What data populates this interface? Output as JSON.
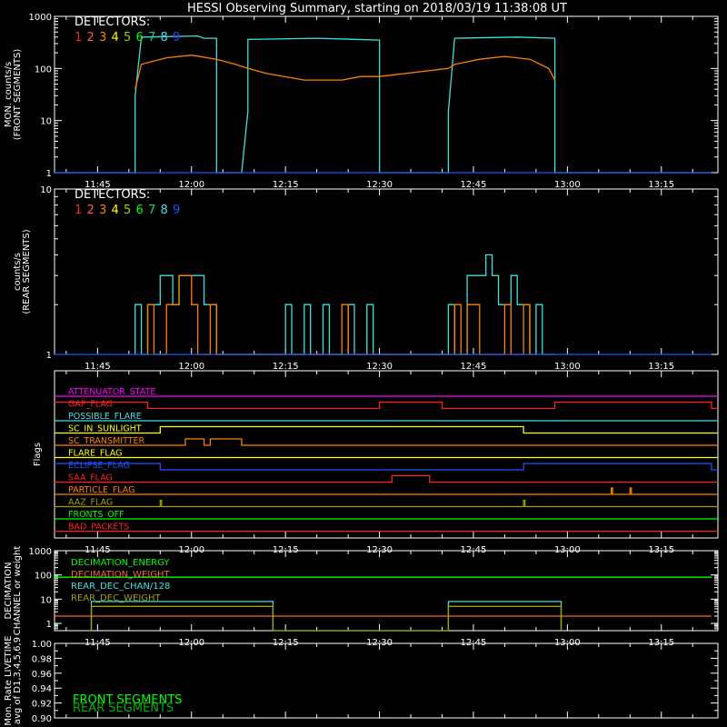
{
  "title": "HESSI Observing Summary, starting on 2018/03/19 11:38:08 UT",
  "chart_data": [
    {
      "type": "line",
      "panel": "monitor-front",
      "ylabel_lines": [
        "MON. counts/s",
        "(FRONT SEGMENTS)"
      ],
      "yscale": "log",
      "ylim": [
        1,
        1000
      ],
      "ytick_labels": [
        "1",
        "10",
        "100",
        "1000"
      ],
      "xlim_minutes_after_1138": [
        0,
        105.9
      ],
      "xtick_labels": [
        "11:45",
        "12:00",
        "12:15",
        "12:30",
        "12:45",
        "13:00",
        "13:15"
      ],
      "legend_title": "DETECTORS:",
      "legend_entries": [
        "1",
        "2",
        "3",
        "4",
        "5",
        "6",
        "7",
        "8",
        "9"
      ],
      "legend_colors": [
        "#ff2020",
        "#ff5555",
        "#ff8000",
        "#ffff00",
        "#a0d000",
        "#00ff00",
        "#00d0a0",
        "#40e0e0",
        "#2050ff"
      ],
      "series": [
        {
          "name": "8",
          "color": "#40e0e0",
          "points": [
            [
              "11:38",
              1
            ],
            [
              "11:51",
              1
            ],
            [
              "11:51",
              30
            ],
            [
              "11:52",
              400
            ],
            [
              "12:01",
              420
            ],
            [
              "12:02",
              380
            ],
            [
              "12:04",
              380
            ],
            [
              "12:04",
              1
            ],
            [
              "12:08",
              1
            ],
            [
              "12:09",
              15
            ],
            [
              "12:09",
              360
            ],
            [
              "12:20",
              380
            ],
            [
              "12:30",
              350
            ],
            [
              "12:30",
              1
            ],
            [
              "12:41",
              1
            ],
            [
              "12:41",
              15
            ],
            [
              "12:42",
              380
            ],
            [
              "12:52",
              400
            ],
            [
              "12:58",
              380
            ],
            [
              "12:58",
              1
            ],
            [
              "13:23",
              1
            ]
          ]
        },
        {
          "name": "3",
          "color": "#ff8000",
          "points": [
            [
              "11:51",
              40
            ],
            [
              "11:52",
              120
            ],
            [
              "11:56",
              160
            ],
            [
              "12:00",
              180
            ],
            [
              "12:04",
              150
            ],
            [
              "12:07",
              120
            ],
            [
              "12:09",
              100
            ],
            [
              "12:12",
              80
            ],
            [
              "12:18",
              60
            ],
            [
              "12:24",
              60
            ],
            [
              "12:27",
              70
            ],
            [
              "12:30",
              70
            ],
            [
              "12:41",
              100
            ],
            [
              "12:42",
              120
            ],
            [
              "12:46",
              150
            ],
            [
              "12:50",
              170
            ],
            [
              "12:54",
              150
            ],
            [
              "12:57",
              100
            ],
            [
              "12:58",
              60
            ]
          ]
        },
        {
          "name": "9",
          "color": "#2050ff",
          "points": [
            [
              "11:38",
              1
            ],
            [
              "13:23",
              1
            ]
          ]
        }
      ]
    },
    {
      "type": "line",
      "panel": "rear",
      "ylabel_lines": [
        "counts/s",
        "(REAR SEGMENTS)"
      ],
      "yscale": "log",
      "ylim": [
        1,
        10
      ],
      "ytick_labels": [
        "1",
        "10"
      ],
      "xtick_labels": [
        "11:45",
        "12:00",
        "12:15",
        "12:30",
        "12:45",
        "13:00",
        "13:15"
      ],
      "legend_title": "DETECTORS:",
      "legend_entries": [
        "1",
        "2",
        "3",
        "4",
        "5",
        "6",
        "7",
        "8",
        "9"
      ],
      "legend_colors": [
        "#ff2020",
        "#ff5555",
        "#ff8000",
        "#ffff00",
        "#a0d000",
        "#00ff00",
        "#00d0a0",
        "#40e0e0",
        "#2050ff"
      ],
      "series": [
        {
          "name": "8",
          "color": "#40e0e0",
          "points": [
            [
              "11:51",
              1
            ],
            [
              "11:51",
              2
            ],
            [
              "11:52",
              2
            ],
            [
              "11:52",
              1
            ],
            [
              "11:53",
              1
            ],
            [
              "11:53",
              2
            ],
            [
              "11:55",
              2
            ],
            [
              "11:55",
              3
            ],
            [
              "11:57",
              3
            ],
            [
              "11:57",
              2
            ],
            [
              "11:58",
              2
            ],
            [
              "11:58",
              3
            ],
            [
              "12:02",
              3
            ],
            [
              "12:02",
              2
            ],
            [
              "12:04",
              2
            ],
            [
              "12:04",
              1
            ],
            [
              "12:15",
              1
            ],
            [
              "12:15",
              2
            ],
            [
              "12:16",
              2
            ],
            [
              "12:16",
              1
            ],
            [
              "12:18",
              1
            ],
            [
              "12:18",
              2
            ],
            [
              "12:19",
              2
            ],
            [
              "12:19",
              1
            ],
            [
              "12:21",
              1
            ],
            [
              "12:21",
              2
            ],
            [
              "12:22",
              2
            ],
            [
              "12:22",
              1
            ],
            [
              "12:25",
              1
            ],
            [
              "12:25",
              2
            ],
            [
              "12:26",
              2
            ],
            [
              "12:26",
              1
            ],
            [
              "12:28",
              1
            ],
            [
              "12:28",
              2
            ],
            [
              "12:29",
              2
            ],
            [
              "12:29",
              1
            ],
            [
              "12:41",
              1
            ],
            [
              "12:41",
              2
            ],
            [
              "12:42",
              2
            ],
            [
              "12:42",
              1
            ],
            [
              "12:44",
              1
            ],
            [
              "12:44",
              3
            ],
            [
              "12:47",
              3
            ],
            [
              "12:47",
              4
            ],
            [
              "12:48",
              4
            ],
            [
              "12:48",
              3
            ],
            [
              "12:49",
              3
            ],
            [
              "12:49",
              2
            ],
            [
              "12:51",
              2
            ],
            [
              "12:51",
              3
            ],
            [
              "12:52",
              3
            ],
            [
              "12:52",
              2
            ],
            [
              "12:54",
              2
            ],
            [
              "12:54",
              1
            ],
            [
              "12:55",
              1
            ],
            [
              "12:55",
              2
            ],
            [
              "12:56",
              2
            ],
            [
              "12:56",
              1
            ],
            [
              "12:58",
              1
            ]
          ]
        },
        {
          "name": "3",
          "color": "#ff8000",
          "points": [
            [
              "11:53",
              1
            ],
            [
              "11:53",
              2
            ],
            [
              "11:54",
              2
            ],
            [
              "11:54",
              1
            ],
            [
              "11:56",
              1
            ],
            [
              "11:56",
              2
            ],
            [
              "11:58",
              2
            ],
            [
              "11:58",
              3
            ],
            [
              "12:00",
              3
            ],
            [
              "12:00",
              2
            ],
            [
              "12:01",
              2
            ],
            [
              "12:01",
              1
            ],
            [
              "12:03",
              1
            ],
            [
              "12:03",
              2
            ],
            [
              "12:04",
              2
            ],
            [
              "12:04",
              1
            ],
            [
              "12:24",
              1
            ],
            [
              "12:24",
              2
            ],
            [
              "12:25",
              2
            ],
            [
              "12:25",
              1
            ],
            [
              "12:42",
              1
            ],
            [
              "12:42",
              2
            ],
            [
              "12:43",
              2
            ],
            [
              "12:43",
              1
            ],
            [
              "12:44",
              1
            ],
            [
              "12:44",
              2
            ],
            [
              "12:46",
              2
            ],
            [
              "12:46",
              1
            ],
            [
              "12:50",
              1
            ],
            [
              "12:50",
              2
            ],
            [
              "12:51",
              2
            ],
            [
              "12:51",
              1
            ],
            [
              "12:53",
              1
            ],
            [
              "12:53",
              2
            ],
            [
              "12:54",
              2
            ],
            [
              "12:54",
              1
            ]
          ]
        },
        {
          "name": "9",
          "color": "#2050ff",
          "points": [
            [
              "11:38",
              1
            ],
            [
              "13:23",
              1
            ]
          ]
        }
      ]
    },
    {
      "type": "line",
      "panel": "flags",
      "ylabel": "Flags",
      "xtick_labels": [
        "11:45",
        "12:00",
        "12:15",
        "12:30",
        "12:45",
        "13:00",
        "13:15"
      ],
      "flags": [
        {
          "label": "ATTENUATOR_STATE",
          "color": "#ff00ff",
          "high_intervals": []
        },
        {
          "label": "GAP_FLAG",
          "color": "#ff2020",
          "high_intervals": [
            [
              "11:38",
              "11:53"
            ],
            [
              "12:30",
              "12:40"
            ],
            [
              "12:58",
              "13:23"
            ]
          ]
        },
        {
          "label": "POSSIBLE_FLARE",
          "color": "#40e0e0",
          "high_intervals": []
        },
        {
          "label": "SC_IN_SUNLIGHT",
          "color": "#ffff00",
          "high_intervals": [
            [
              "11:55",
              "12:53"
            ]
          ]
        },
        {
          "label": "SC_TRANSMITTER",
          "color": "#ff8000",
          "high_intervals": [
            [
              "11:59",
              "12:02"
            ],
            [
              "12:03",
              "12:08"
            ]
          ]
        },
        {
          "label": "FLARE_FLAG",
          "color": "#ffff00",
          "high_intervals": []
        },
        {
          "label": "ECLIPSE_FLAG",
          "color": "#2050ff",
          "high_intervals": [
            [
              "11:38",
              "11:55"
            ],
            [
              "12:53",
              "13:23"
            ]
          ]
        },
        {
          "label": "SAA_FLAG",
          "color": "#ff2020",
          "high_intervals": [
            [
              "12:32",
              "12:38"
            ]
          ]
        },
        {
          "label": "PARTICLE_FLAG",
          "color": "#ff8000",
          "high_intervals": [
            [
              "13:07",
              "13:07"
            ],
            [
              "13:10",
              "13:10"
            ]
          ]
        },
        {
          "label": "AAZ_FLAG",
          "color": "#a0a000",
          "high_intervals": [
            [
              "11:55",
              "11:55"
            ],
            [
              "12:53",
              "12:53"
            ]
          ]
        },
        {
          "label": "FRONTS_OFF",
          "color": "#00ff00",
          "high_intervals": []
        },
        {
          "label": "BAD_PACKETS",
          "color": "#ff2020",
          "high_intervals": []
        }
      ]
    },
    {
      "type": "line",
      "panel": "decimation",
      "ylabel_lines": [
        "DECIMATION",
        "CHANNEL or weight"
      ],
      "yscale": "log",
      "ylim": [
        0.5,
        1000
      ],
      "ytick_labels": [
        "1",
        "10",
        "100",
        "1000"
      ],
      "xtick_labels": [
        "11:45",
        "12:00",
        "12:15",
        "12:30",
        "12:45",
        "13:00",
        "13:15"
      ],
      "series": [
        {
          "name": "DECIMATION_ENERGY",
          "color": "#00ff00",
          "points": [
            [
              "11:38",
              80
            ],
            [
              "13:23",
              80
            ]
          ]
        },
        {
          "name": "DECIMATION_WEIGHT",
          "color": "#ff6040",
          "points": [
            [
              "11:38",
              2
            ],
            [
              "13:23",
              2
            ]
          ]
        },
        {
          "name": "REAR_DEC_CHAN/128",
          "color": "#40e0e0",
          "points": [
            [
              "11:44",
              0.5
            ],
            [
              "11:44",
              8
            ],
            [
              "12:13",
              8
            ],
            [
              "12:13",
              0.5
            ],
            [
              "12:41",
              0.5
            ],
            [
              "12:41",
              8
            ],
            [
              "12:59",
              8
            ],
            [
              "12:59",
              0.5
            ]
          ]
        },
        {
          "name": "REAR_DEC_WEIGHT",
          "color": "#a0a000",
          "points": [
            [
              "11:44",
              0.5
            ],
            [
              "11:44",
              5
            ],
            [
              "12:13",
              5
            ],
            [
              "12:13",
              0.5
            ],
            [
              "12:41",
              0.5
            ],
            [
              "12:41",
              5
            ],
            [
              "12:59",
              5
            ],
            [
              "12:59",
              0.5
            ]
          ]
        }
      ]
    },
    {
      "type": "line",
      "panel": "livetime",
      "ylabel_lines": [
        "Mon. Rate LIVETIME",
        "avg of D1,3,4,5,6,9"
      ],
      "ylim": [
        0.9,
        1.0
      ],
      "ytick_labels": [
        "0.90",
        "0.92",
        "0.94",
        "0.96",
        "0.98",
        "1.00"
      ],
      "series": [
        {
          "name": "FRONT SEGMENTS",
          "color": "#00ff00",
          "points": []
        },
        {
          "name": "REAR SEGMENTS",
          "color": "#00b000",
          "points": []
        }
      ]
    }
  ]
}
